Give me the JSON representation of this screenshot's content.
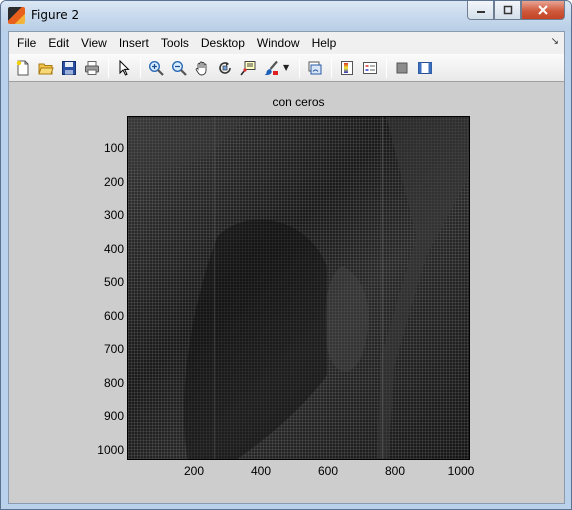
{
  "window": {
    "title": "Figure 2"
  },
  "menu": [
    "File",
    "Edit",
    "View",
    "Insert",
    "Tools",
    "Desktop",
    "Window",
    "Help"
  ],
  "toolbar": {
    "icons": [
      "new-figure-icon",
      "open-file-icon",
      "save-icon",
      "print-icon",
      "edit-plot-arrow-icon",
      "zoom-in-icon",
      "zoom-out-icon",
      "pan-hand-icon",
      "rotate-3d-icon",
      "data-cursor-icon",
      "brush-icon",
      "link-plot-icon",
      "insert-colorbar-icon",
      "insert-legend-icon",
      "hide-plot-tools-icon",
      "show-plot-tools-icon"
    ]
  },
  "plot": {
    "title": "con ceros",
    "yticks": [
      "100",
      "200",
      "300",
      "400",
      "500",
      "600",
      "700",
      "800",
      "900",
      "1000"
    ],
    "xticks": [
      "200",
      "400",
      "600",
      "800",
      "1000"
    ]
  },
  "chart_data": {
    "type": "heatmap",
    "title": "con ceros",
    "xlabel": "",
    "ylabel": "",
    "xlim": [
      0.5,
      1024.5
    ],
    "ylim": [
      0.5,
      1024.5
    ],
    "y_reversed": true,
    "xticks": [
      200,
      400,
      600,
      800,
      1000
    ],
    "yticks": [
      100,
      200,
      300,
      400,
      500,
      600,
      700,
      800,
      900,
      1000
    ],
    "colormap": "gray"
  }
}
